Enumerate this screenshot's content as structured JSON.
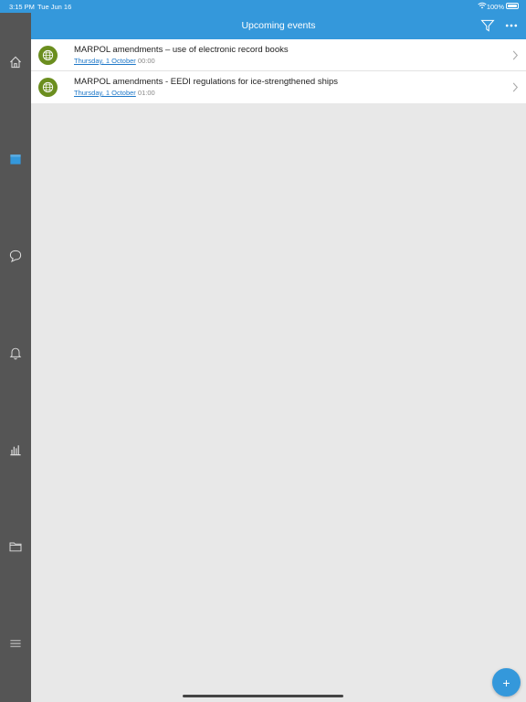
{
  "status_bar": {
    "time": "3:15 PM",
    "date": "Tue Jun 16",
    "battery": "100%"
  },
  "sidebar": {
    "items": [
      {
        "icon": "home-icon"
      },
      {
        "icon": "calendar-icon",
        "active": true
      },
      {
        "icon": "chat-icon"
      },
      {
        "icon": "bell-icon"
      },
      {
        "icon": "bar-chart-icon"
      },
      {
        "icon": "folder-icon"
      },
      {
        "icon": "menu-icon"
      }
    ]
  },
  "header": {
    "title": "Upcoming events"
  },
  "events": [
    {
      "title": "MARPOL amendments – use of electronic record books",
      "date": "Thursday, 1 October",
      "time": "00:00"
    },
    {
      "title": "MARPOL amendments - EEDI regulations for ice-strengthened ships",
      "date": "Thursday, 1 October",
      "time": "01:00"
    }
  ],
  "colors": {
    "accent": "#3498db",
    "sidebar": "#555555",
    "event_icon": "#6b8e1f",
    "link": "#1f78c8"
  },
  "fab": {
    "label": "+"
  }
}
